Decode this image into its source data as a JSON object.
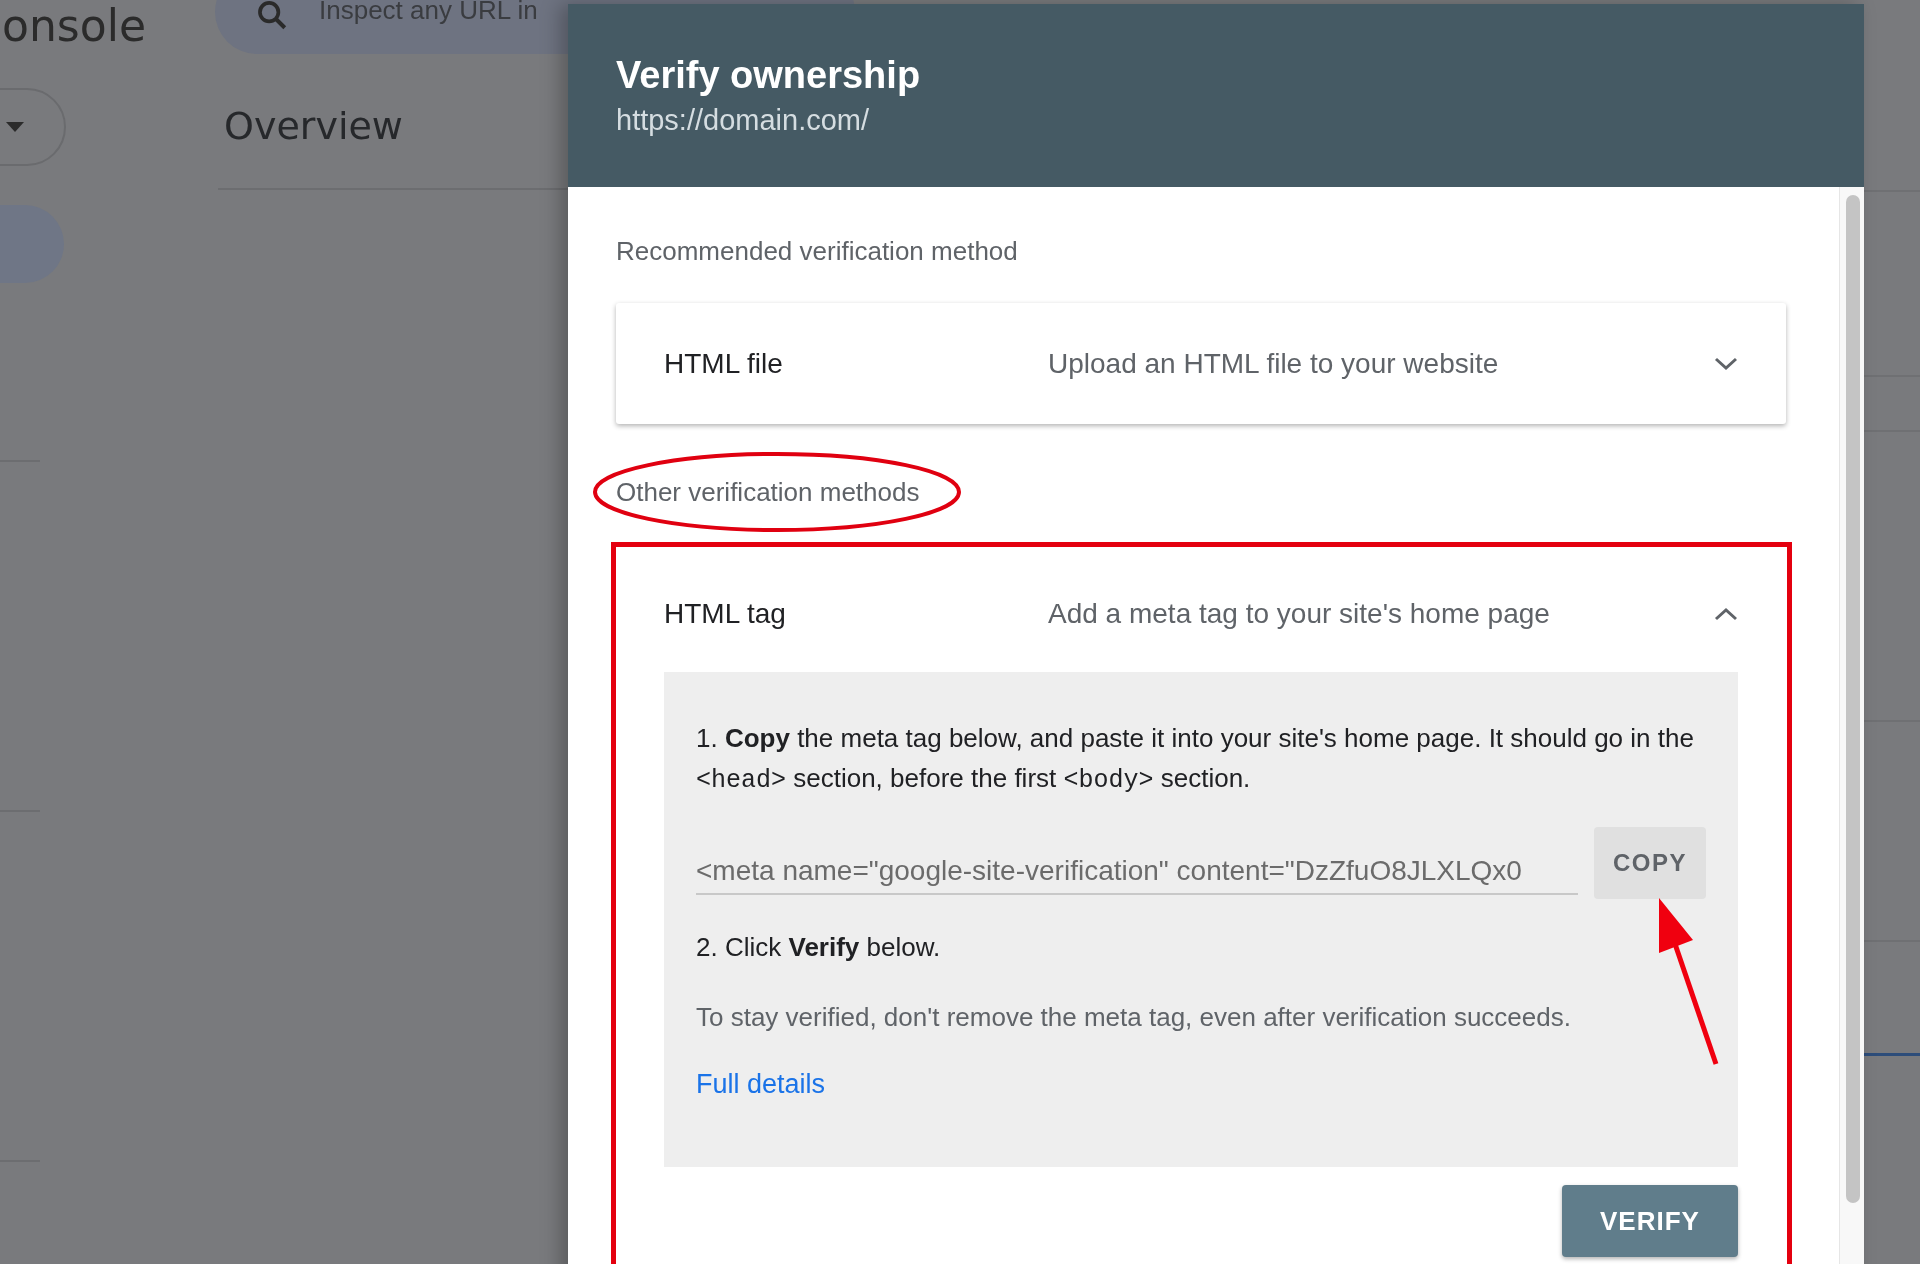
{
  "background": {
    "logo_text": "onsole",
    "search": {
      "placeholder": "Inspect any URL in"
    },
    "page_title": "Overview"
  },
  "dialog": {
    "title": "Verify ownership",
    "url": "https://domain.com/",
    "recommended_label": "Recommended verification method",
    "methods": [
      {
        "name": "HTML file",
        "description": "Upload an HTML file to your website",
        "expanded": false
      }
    ],
    "other_label": "Other verification methods",
    "other_methods": [
      {
        "name": "HTML tag",
        "description": "Add a meta tag to your site's home page",
        "expanded": true,
        "step_1": [
          {
            "kind": "text",
            "text": "1. **Copy** the meta tag below, and paste it into your site's home page. It should go in the "
          },
          {
            "kind": "code",
            "text": "<head>"
          },
          {
            "kind": "text",
            "text": " section, before the first "
          },
          {
            "kind": "code",
            "text": "<body>"
          },
          {
            "kind": "text",
            "text": " section."
          }
        ],
        "meta_tag": "<meta name=\"google-site-verification\" content=\"DzZfuO8JLXLQx0",
        "copy_button": "COPY",
        "step_2": "2. Click **Verify** below.",
        "note": "To stay verified, don't remove the meta tag, even after verification succeeds.",
        "link": "Full details",
        "verify_button": "VERIFY"
      }
    ]
  }
}
